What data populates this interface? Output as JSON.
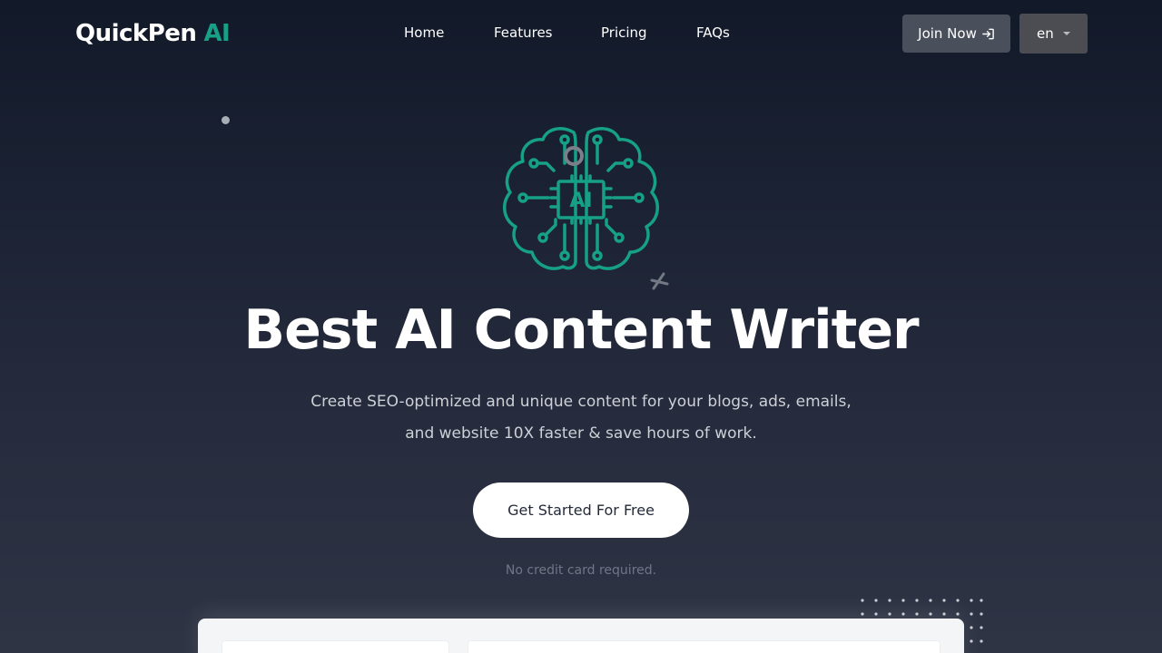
{
  "nav": {
    "logo_brand": "QuickPen",
    "logo_accent": "AI",
    "links": [
      "Home",
      "Features",
      "Pricing",
      "FAQs"
    ],
    "join_label": "Join Now",
    "language": "en"
  },
  "hero": {
    "title": "Best AI Content Writer",
    "subtitle": "Create SEO-optimized and unique content for your blogs, ads, emails, and website 10X faster & save hours of work.",
    "cta_label": "Get Started For Free",
    "note": "No credit card required.",
    "chip_label": "AI"
  },
  "colors": {
    "accent": "#16a085",
    "background_top": "#121929",
    "background_bottom": "#2e3444",
    "button_dark": "#4a4f5c",
    "cta_bg": "#ffffff"
  },
  "icons": {
    "join": "sign-in-icon",
    "language": "caret-down-icon",
    "hero": "brain-chip-icon"
  }
}
